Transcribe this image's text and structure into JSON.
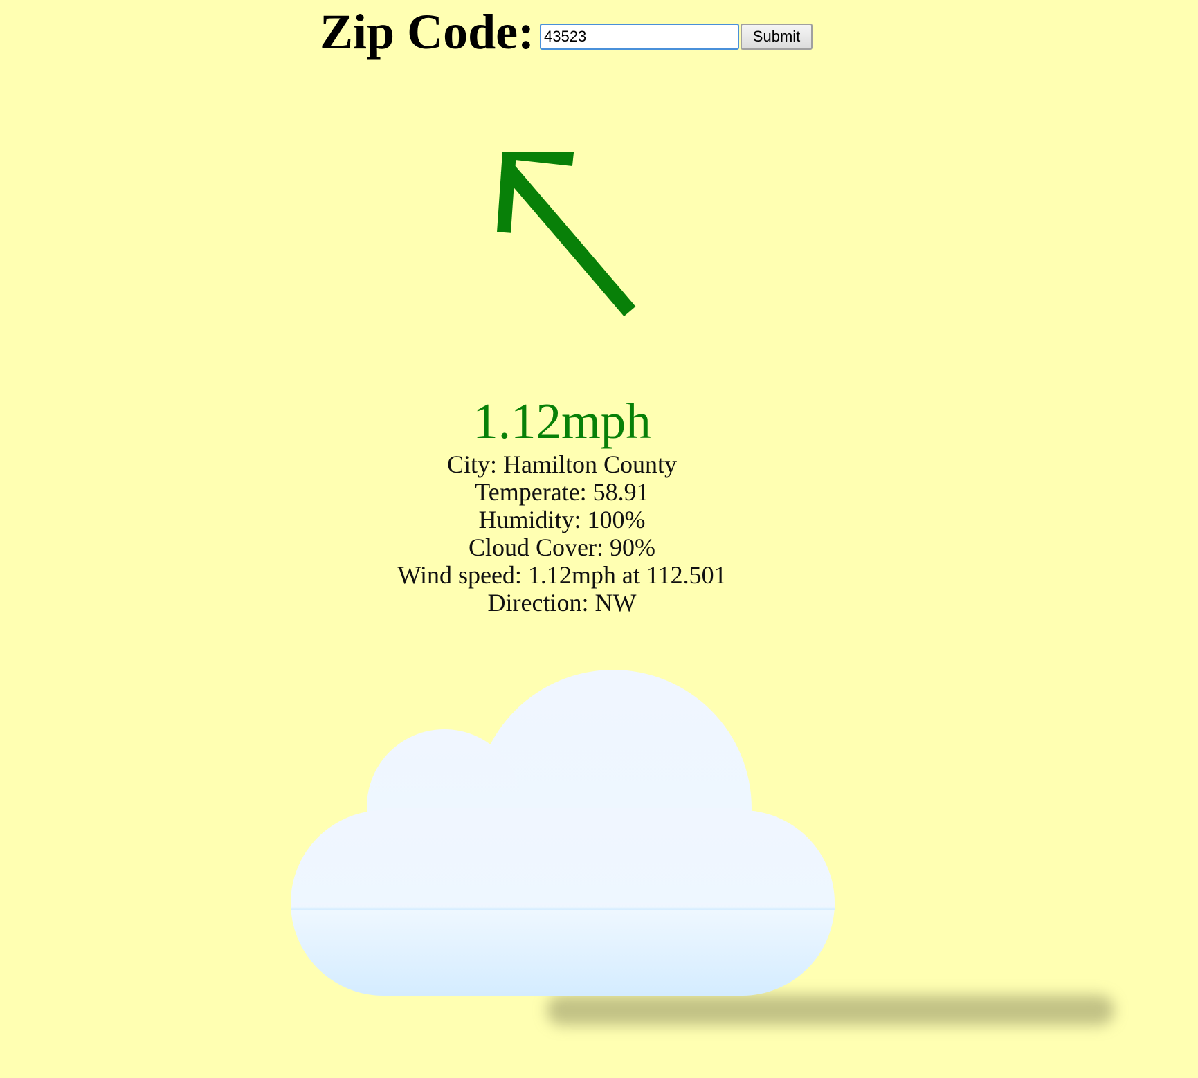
{
  "form": {
    "label": "Zip Code:",
    "input_value": "43523",
    "submit_label": "Submit"
  },
  "wind": {
    "speed_display": "1.12mph",
    "direction_word": "NW",
    "arrow_color": "#088008"
  },
  "details": {
    "city": "City: Hamilton County",
    "temperature": "Temperate: 58.91",
    "humidity": "Humidity: 100%",
    "cloud_cover": "Cloud Cover: 90%",
    "wind_speed": "Wind speed: 1.12mph at 112.501",
    "direction": "Direction: NW"
  },
  "colors": {
    "background": "#ffffb2",
    "speed_text": "#088008",
    "cloud_top": "#f0f6ff",
    "cloud_bottom": "#d4ecff"
  },
  "icons": {
    "arrow": "wind-direction-arrow-icon",
    "cloud": "cloud-icon"
  }
}
